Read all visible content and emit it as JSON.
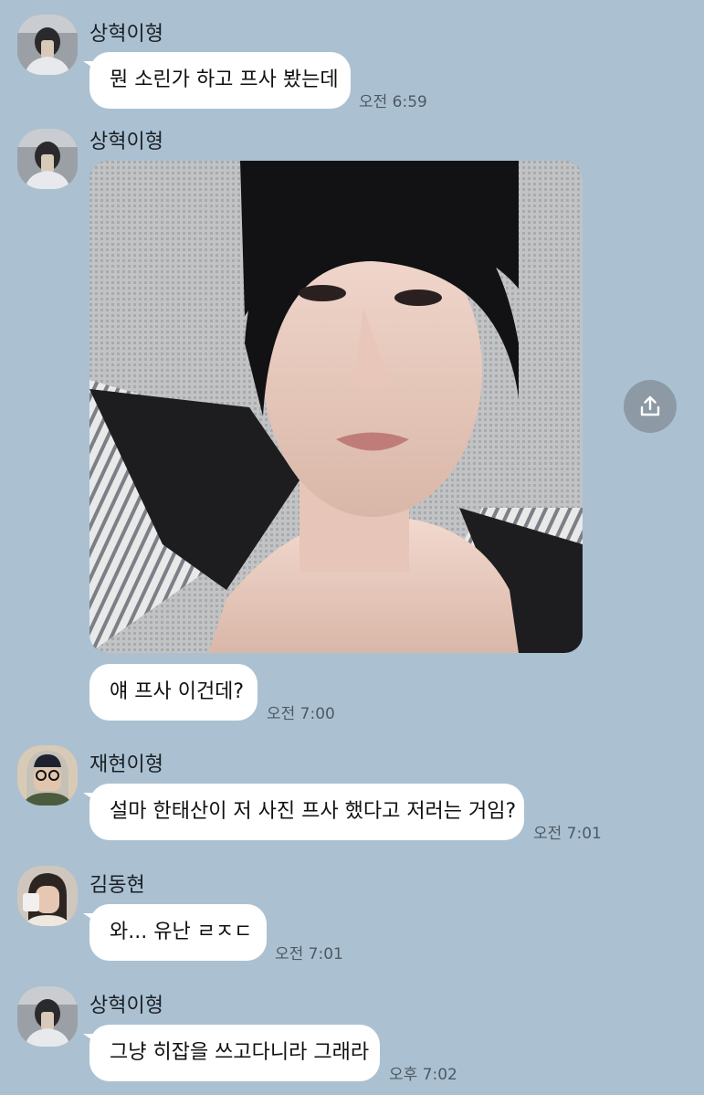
{
  "colors": {
    "background": "#abc1d1",
    "bubble": "#ffffff",
    "text": "#111111",
    "time": "#4e5964",
    "share_button": "#8d9aa5"
  },
  "messages": [
    {
      "sender": "상혁이형",
      "text": "뭔 소린가 하고 프사 봤는데",
      "time": "오전 6:59"
    },
    {
      "sender": "상혁이형",
      "image": "selfie-photo",
      "text": "얘 프사 이건데?",
      "time": "오전 7:00"
    },
    {
      "sender": "재현이형",
      "text": "설마 한태산이 저 사진 프사 했다고 저러는 거임?",
      "time": "오전 7:01"
    },
    {
      "sender": "김동현",
      "text": "와... 유난 ㄹㅈㄷ",
      "time": "오전 7:01"
    },
    {
      "sender": "상혁이형",
      "text": "그냥 히잡을 쓰고다니라 그래라",
      "time": "오후 7:02"
    }
  ],
  "share_icon": "share-icon"
}
